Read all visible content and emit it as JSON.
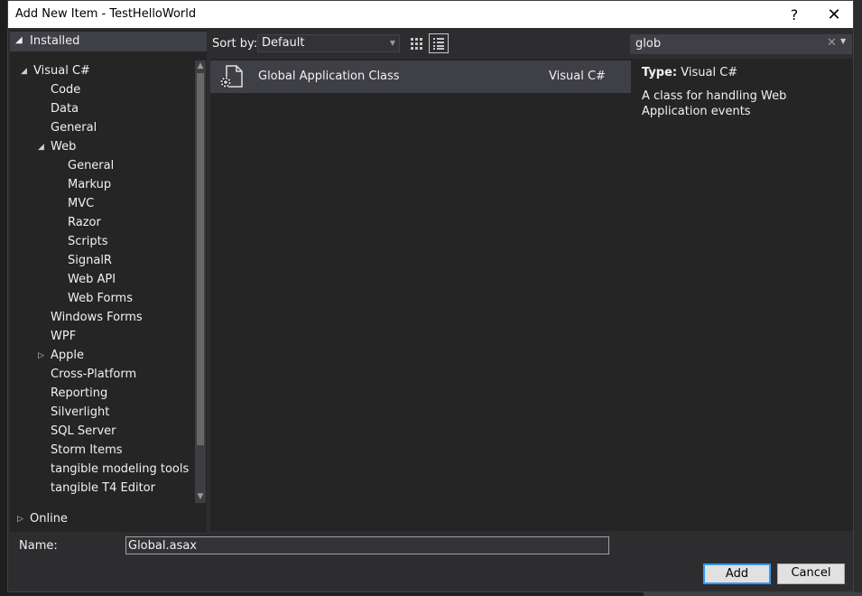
{
  "window": {
    "title": "Add New Item - TestHelloWorld",
    "help": "?",
    "close": "✕"
  },
  "tree": {
    "installed": "Installed",
    "items": [
      {
        "label": "Visual C#",
        "level": 0,
        "expanded": true
      },
      {
        "label": "Code",
        "level": 1
      },
      {
        "label": "Data",
        "level": 1
      },
      {
        "label": "General",
        "level": 1
      },
      {
        "label": "Web",
        "level": 1,
        "expanded": true
      },
      {
        "label": "General",
        "level": 2
      },
      {
        "label": "Markup",
        "level": 2
      },
      {
        "label": "MVC",
        "level": 2
      },
      {
        "label": "Razor",
        "level": 2
      },
      {
        "label": "Scripts",
        "level": 2
      },
      {
        "label": "SignalR",
        "level": 2
      },
      {
        "label": "Web API",
        "level": 2
      },
      {
        "label": "Web Forms",
        "level": 2
      },
      {
        "label": "Windows Forms",
        "level": 1
      },
      {
        "label": "WPF",
        "level": 1
      },
      {
        "label": "Apple",
        "level": 1,
        "expanded": false
      },
      {
        "label": "Cross-Platform",
        "level": 1
      },
      {
        "label": "Reporting",
        "level": 1
      },
      {
        "label": "Silverlight",
        "level": 1
      },
      {
        "label": "SQL Server",
        "level": 1
      },
      {
        "label": "Storm Items",
        "level": 1
      },
      {
        "label": "tangible modeling tools",
        "level": 1
      },
      {
        "label": "tangible T4 Editor",
        "level": 1
      }
    ],
    "online": "Online"
  },
  "sort": {
    "label": "Sort by:",
    "value": "Default"
  },
  "templates": [
    {
      "name": "Global Application Class",
      "language": "Visual C#",
      "icon": "global-application-class-icon"
    }
  ],
  "search": {
    "value": "glob",
    "clear_icon": "✕",
    "dropdown_icon": "▾"
  },
  "details": {
    "type_label": "Type:",
    "type_value": "Visual C#",
    "description": "A class for handling Web Application events"
  },
  "name_field": {
    "label": "Name:",
    "value": "Global.asax"
  },
  "buttons": {
    "add": "Add",
    "cancel": "Cancel"
  },
  "colors": {
    "accent": "#3399ff",
    "background": "#2d2d30",
    "panel": "#252526",
    "selection": "#3f3f46"
  }
}
